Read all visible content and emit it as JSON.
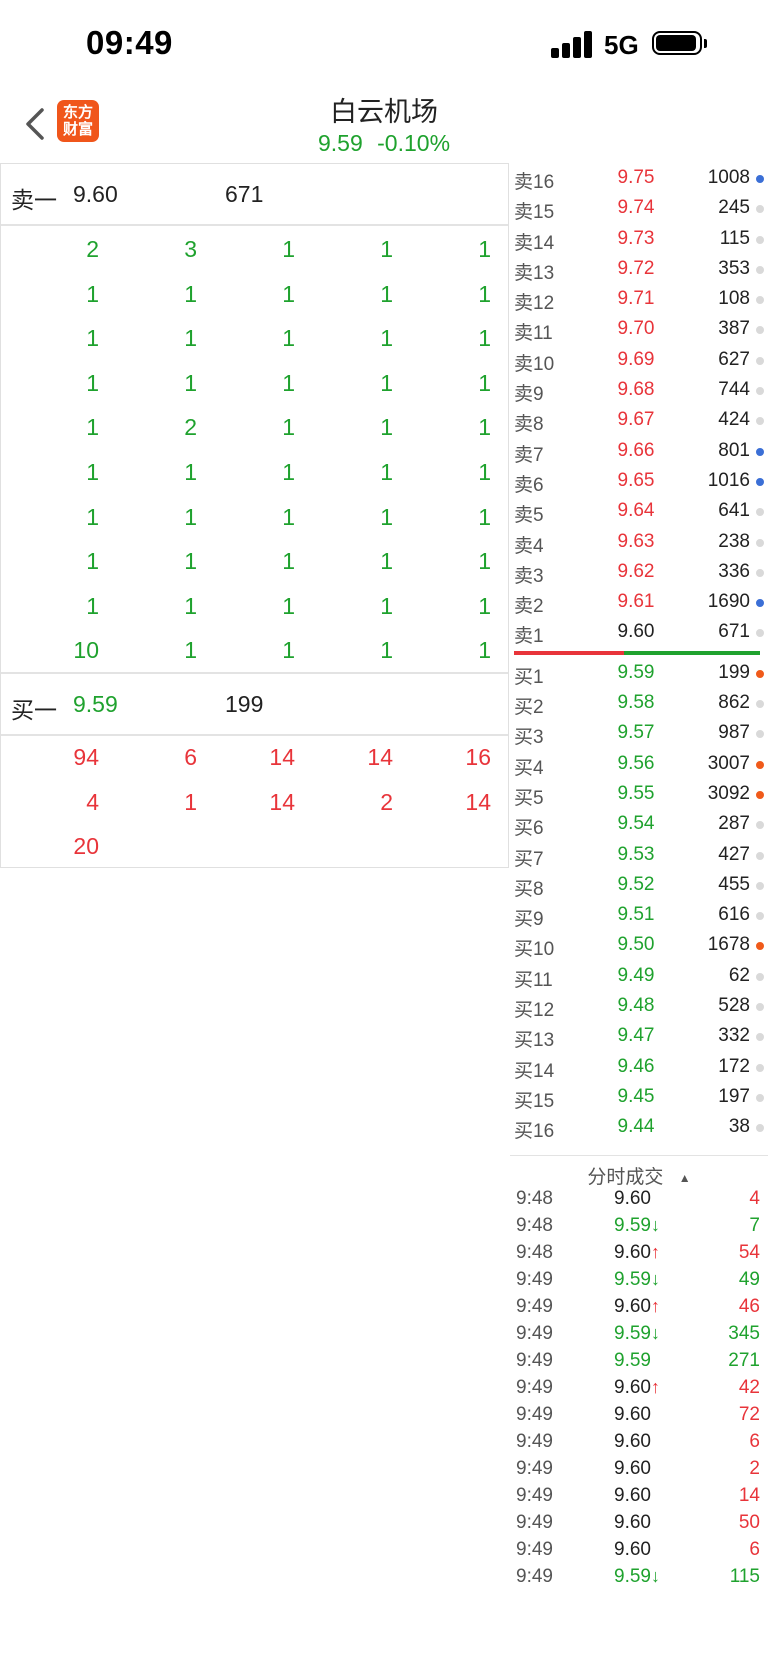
{
  "status_bar": {
    "time": "09:49",
    "network": "5G"
  },
  "header": {
    "title": "白云机场",
    "price": "9.59",
    "change_pct": "-0.10%",
    "logo_text": "东方财富",
    "logo_line1": "东方",
    "logo_line2": "财富"
  },
  "colors": {
    "up": "#e8343a",
    "down": "#1fa22e",
    "logo": "#f0561b",
    "dot_blue": "#3b6fd6",
    "dot_orange": "#f05a1a"
  },
  "left_panel": {
    "sell_best": {
      "label": "卖一",
      "price": "9.60",
      "volume": "671"
    },
    "sell_queue": [
      [
        "2",
        "3",
        "1",
        "1",
        "1"
      ],
      [
        "1",
        "1",
        "1",
        "1",
        "1"
      ],
      [
        "1",
        "1",
        "1",
        "1",
        "1"
      ],
      [
        "1",
        "1",
        "1",
        "1",
        "1"
      ],
      [
        "1",
        "2",
        "1",
        "1",
        "1"
      ],
      [
        "1",
        "1",
        "1",
        "1",
        "1"
      ],
      [
        "1",
        "1",
        "1",
        "1",
        "1"
      ],
      [
        "1",
        "1",
        "1",
        "1",
        "1"
      ],
      [
        "1",
        "1",
        "1",
        "1",
        "1"
      ],
      [
        "10",
        "1",
        "1",
        "1",
        "1"
      ]
    ],
    "buy_best": {
      "label": "买一",
      "price": "9.59",
      "volume": "199"
    },
    "buy_queue": [
      [
        "94",
        "6",
        "14",
        "14",
        "16"
      ],
      [
        "4",
        "1",
        "14",
        "2",
        "14"
      ],
      [
        "20",
        "",
        "",
        "",
        ""
      ]
    ]
  },
  "order_book": {
    "asks": [
      {
        "label": "卖16",
        "price": "9.75",
        "volume": "1008",
        "dot": "blue"
      },
      {
        "label": "卖15",
        "price": "9.74",
        "volume": "245",
        "dot": "light"
      },
      {
        "label": "卖14",
        "price": "9.73",
        "volume": "115",
        "dot": "light"
      },
      {
        "label": "卖13",
        "price": "9.72",
        "volume": "353",
        "dot": "light"
      },
      {
        "label": "卖12",
        "price": "9.71",
        "volume": "108",
        "dot": "light"
      },
      {
        "label": "卖11",
        "price": "9.70",
        "volume": "387",
        "dot": "light"
      },
      {
        "label": "卖10",
        "price": "9.69",
        "volume": "627",
        "dot": "light"
      },
      {
        "label": "卖9",
        "price": "9.68",
        "volume": "744",
        "dot": "light"
      },
      {
        "label": "卖8",
        "price": "9.67",
        "volume": "424",
        "dot": "light"
      },
      {
        "label": "卖7",
        "price": "9.66",
        "volume": "801",
        "dot": "blue"
      },
      {
        "label": "卖6",
        "price": "9.65",
        "volume": "1016",
        "dot": "blue"
      },
      {
        "label": "卖5",
        "price": "9.64",
        "volume": "641",
        "dot": "light"
      },
      {
        "label": "卖4",
        "price": "9.63",
        "volume": "238",
        "dot": "light"
      },
      {
        "label": "卖3",
        "price": "9.62",
        "volume": "336",
        "dot": "light"
      },
      {
        "label": "卖2",
        "price": "9.61",
        "volume": "1690",
        "dot": "blue"
      },
      {
        "label": "卖1",
        "price": "9.60",
        "volume": "671",
        "dot": "light"
      }
    ],
    "bids": [
      {
        "label": "买1",
        "price": "9.59",
        "volume": "199",
        "dot": "orange"
      },
      {
        "label": "买2",
        "price": "9.58",
        "volume": "862",
        "dot": "light"
      },
      {
        "label": "买3",
        "price": "9.57",
        "volume": "987",
        "dot": "light"
      },
      {
        "label": "买4",
        "price": "9.56",
        "volume": "3007",
        "dot": "orange"
      },
      {
        "label": "买5",
        "price": "9.55",
        "volume": "3092",
        "dot": "orange"
      },
      {
        "label": "买6",
        "price": "9.54",
        "volume": "287",
        "dot": "light"
      },
      {
        "label": "买7",
        "price": "9.53",
        "volume": "427",
        "dot": "light"
      },
      {
        "label": "买8",
        "price": "9.52",
        "volume": "455",
        "dot": "light"
      },
      {
        "label": "买9",
        "price": "9.51",
        "volume": "616",
        "dot": "light"
      },
      {
        "label": "买10",
        "price": "9.50",
        "volume": "1678",
        "dot": "orange"
      },
      {
        "label": "买11",
        "price": "9.49",
        "volume": "62",
        "dot": "light"
      },
      {
        "label": "买12",
        "price": "9.48",
        "volume": "528",
        "dot": "light"
      },
      {
        "label": "买13",
        "price": "9.47",
        "volume": "332",
        "dot": "light"
      },
      {
        "label": "买14",
        "price": "9.46",
        "volume": "172",
        "dot": "light"
      },
      {
        "label": "买15",
        "price": "9.45",
        "volume": "197",
        "dot": "light"
      },
      {
        "label": "买16",
        "price": "9.44",
        "volume": "38",
        "dot": "light"
      }
    ]
  },
  "trades": {
    "header": "分时成交",
    "rows": [
      {
        "time": "9:48",
        "price": "9.60",
        "arrow": "",
        "volume": "4",
        "price_color": "gray",
        "vol_color": "red"
      },
      {
        "time": "9:48",
        "price": "9.59",
        "arrow": "↓",
        "volume": "7",
        "price_color": "green",
        "vol_color": "green"
      },
      {
        "time": "9:48",
        "price": "9.60",
        "arrow": "↑",
        "volume": "54",
        "price_color": "gray",
        "vol_color": "red"
      },
      {
        "time": "9:49",
        "price": "9.59",
        "arrow": "↓",
        "volume": "49",
        "price_color": "green",
        "vol_color": "green"
      },
      {
        "time": "9:49",
        "price": "9.60",
        "arrow": "↑",
        "volume": "46",
        "price_color": "gray",
        "vol_color": "red"
      },
      {
        "time": "9:49",
        "price": "9.59",
        "arrow": "↓",
        "volume": "345",
        "price_color": "green",
        "vol_color": "green"
      },
      {
        "time": "9:49",
        "price": "9.59",
        "arrow": "",
        "volume": "271",
        "price_color": "green",
        "vol_color": "green"
      },
      {
        "time": "9:49",
        "price": "9.60",
        "arrow": "↑",
        "volume": "42",
        "price_color": "gray",
        "vol_color": "red"
      },
      {
        "time": "9:49",
        "price": "9.60",
        "arrow": "",
        "volume": "72",
        "price_color": "gray",
        "vol_color": "red"
      },
      {
        "time": "9:49",
        "price": "9.60",
        "arrow": "",
        "volume": "6",
        "price_color": "gray",
        "vol_color": "red"
      },
      {
        "time": "9:49",
        "price": "9.60",
        "arrow": "",
        "volume": "2",
        "price_color": "gray",
        "vol_color": "red"
      },
      {
        "time": "9:49",
        "price": "9.60",
        "arrow": "",
        "volume": "14",
        "price_color": "gray",
        "vol_color": "red"
      },
      {
        "time": "9:49",
        "price": "9.60",
        "arrow": "",
        "volume": "50",
        "price_color": "gray",
        "vol_color": "red"
      },
      {
        "time": "9:49",
        "price": "9.60",
        "arrow": "",
        "volume": "6",
        "price_color": "gray",
        "vol_color": "red"
      },
      {
        "time": "9:49",
        "price": "9.59",
        "arrow": "↓",
        "volume": "115",
        "price_color": "green",
        "vol_color": "green"
      }
    ]
  }
}
